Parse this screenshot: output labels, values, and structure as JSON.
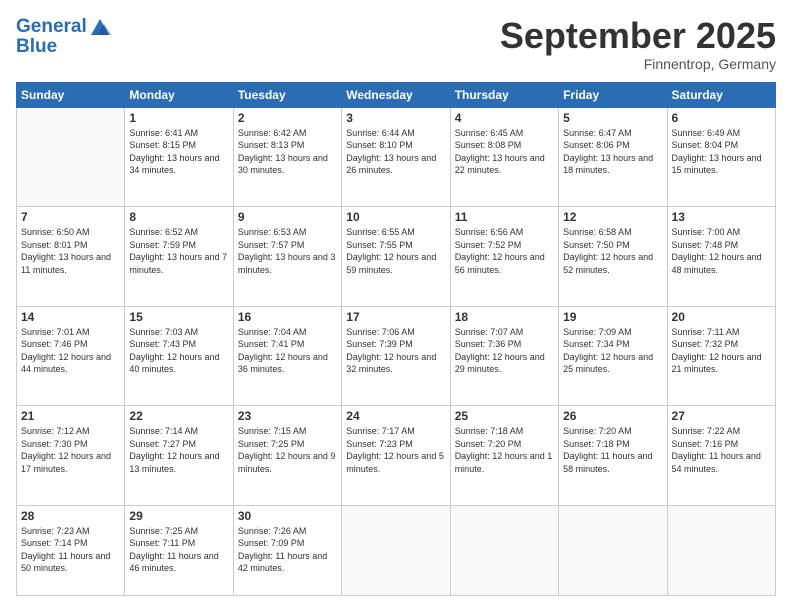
{
  "header": {
    "logo_line1": "General",
    "logo_line2": "Blue",
    "month": "September 2025",
    "location": "Finnentrop, Germany"
  },
  "weekdays": [
    "Sunday",
    "Monday",
    "Tuesday",
    "Wednesday",
    "Thursday",
    "Friday",
    "Saturday"
  ],
  "weeks": [
    [
      {
        "day": "",
        "sunrise": "",
        "sunset": "",
        "daylight": ""
      },
      {
        "day": "1",
        "sunrise": "Sunrise: 6:41 AM",
        "sunset": "Sunset: 8:15 PM",
        "daylight": "Daylight: 13 hours and 34 minutes."
      },
      {
        "day": "2",
        "sunrise": "Sunrise: 6:42 AM",
        "sunset": "Sunset: 8:13 PM",
        "daylight": "Daylight: 13 hours and 30 minutes."
      },
      {
        "day": "3",
        "sunrise": "Sunrise: 6:44 AM",
        "sunset": "Sunset: 8:10 PM",
        "daylight": "Daylight: 13 hours and 26 minutes."
      },
      {
        "day": "4",
        "sunrise": "Sunrise: 6:45 AM",
        "sunset": "Sunset: 8:08 PM",
        "daylight": "Daylight: 13 hours and 22 minutes."
      },
      {
        "day": "5",
        "sunrise": "Sunrise: 6:47 AM",
        "sunset": "Sunset: 8:06 PM",
        "daylight": "Daylight: 13 hours and 18 minutes."
      },
      {
        "day": "6",
        "sunrise": "Sunrise: 6:49 AM",
        "sunset": "Sunset: 8:04 PM",
        "daylight": "Daylight: 13 hours and 15 minutes."
      }
    ],
    [
      {
        "day": "7",
        "sunrise": "Sunrise: 6:50 AM",
        "sunset": "Sunset: 8:01 PM",
        "daylight": "Daylight: 13 hours and 11 minutes."
      },
      {
        "day": "8",
        "sunrise": "Sunrise: 6:52 AM",
        "sunset": "Sunset: 7:59 PM",
        "daylight": "Daylight: 13 hours and 7 minutes."
      },
      {
        "day": "9",
        "sunrise": "Sunrise: 6:53 AM",
        "sunset": "Sunset: 7:57 PM",
        "daylight": "Daylight: 13 hours and 3 minutes."
      },
      {
        "day": "10",
        "sunrise": "Sunrise: 6:55 AM",
        "sunset": "Sunset: 7:55 PM",
        "daylight": "Daylight: 12 hours and 59 minutes."
      },
      {
        "day": "11",
        "sunrise": "Sunrise: 6:56 AM",
        "sunset": "Sunset: 7:52 PM",
        "daylight": "Daylight: 12 hours and 56 minutes."
      },
      {
        "day": "12",
        "sunrise": "Sunrise: 6:58 AM",
        "sunset": "Sunset: 7:50 PM",
        "daylight": "Daylight: 12 hours and 52 minutes."
      },
      {
        "day": "13",
        "sunrise": "Sunrise: 7:00 AM",
        "sunset": "Sunset: 7:48 PM",
        "daylight": "Daylight: 12 hours and 48 minutes."
      }
    ],
    [
      {
        "day": "14",
        "sunrise": "Sunrise: 7:01 AM",
        "sunset": "Sunset: 7:46 PM",
        "daylight": "Daylight: 12 hours and 44 minutes."
      },
      {
        "day": "15",
        "sunrise": "Sunrise: 7:03 AM",
        "sunset": "Sunset: 7:43 PM",
        "daylight": "Daylight: 12 hours and 40 minutes."
      },
      {
        "day": "16",
        "sunrise": "Sunrise: 7:04 AM",
        "sunset": "Sunset: 7:41 PM",
        "daylight": "Daylight: 12 hours and 36 minutes."
      },
      {
        "day": "17",
        "sunrise": "Sunrise: 7:06 AM",
        "sunset": "Sunset: 7:39 PM",
        "daylight": "Daylight: 12 hours and 32 minutes."
      },
      {
        "day": "18",
        "sunrise": "Sunrise: 7:07 AM",
        "sunset": "Sunset: 7:36 PM",
        "daylight": "Daylight: 12 hours and 29 minutes."
      },
      {
        "day": "19",
        "sunrise": "Sunrise: 7:09 AM",
        "sunset": "Sunset: 7:34 PM",
        "daylight": "Daylight: 12 hours and 25 minutes."
      },
      {
        "day": "20",
        "sunrise": "Sunrise: 7:11 AM",
        "sunset": "Sunset: 7:32 PM",
        "daylight": "Daylight: 12 hours and 21 minutes."
      }
    ],
    [
      {
        "day": "21",
        "sunrise": "Sunrise: 7:12 AM",
        "sunset": "Sunset: 7:30 PM",
        "daylight": "Daylight: 12 hours and 17 minutes."
      },
      {
        "day": "22",
        "sunrise": "Sunrise: 7:14 AM",
        "sunset": "Sunset: 7:27 PM",
        "daylight": "Daylight: 12 hours and 13 minutes."
      },
      {
        "day": "23",
        "sunrise": "Sunrise: 7:15 AM",
        "sunset": "Sunset: 7:25 PM",
        "daylight": "Daylight: 12 hours and 9 minutes."
      },
      {
        "day": "24",
        "sunrise": "Sunrise: 7:17 AM",
        "sunset": "Sunset: 7:23 PM",
        "daylight": "Daylight: 12 hours and 5 minutes."
      },
      {
        "day": "25",
        "sunrise": "Sunrise: 7:18 AM",
        "sunset": "Sunset: 7:20 PM",
        "daylight": "Daylight: 12 hours and 1 minute."
      },
      {
        "day": "26",
        "sunrise": "Sunrise: 7:20 AM",
        "sunset": "Sunset: 7:18 PM",
        "daylight": "Daylight: 11 hours and 58 minutes."
      },
      {
        "day": "27",
        "sunrise": "Sunrise: 7:22 AM",
        "sunset": "Sunset: 7:16 PM",
        "daylight": "Daylight: 11 hours and 54 minutes."
      }
    ],
    [
      {
        "day": "28",
        "sunrise": "Sunrise: 7:23 AM",
        "sunset": "Sunset: 7:14 PM",
        "daylight": "Daylight: 11 hours and 50 minutes."
      },
      {
        "day": "29",
        "sunrise": "Sunrise: 7:25 AM",
        "sunset": "Sunset: 7:11 PM",
        "daylight": "Daylight: 11 hours and 46 minutes."
      },
      {
        "day": "30",
        "sunrise": "Sunrise: 7:26 AM",
        "sunset": "Sunset: 7:09 PM",
        "daylight": "Daylight: 11 hours and 42 minutes."
      },
      {
        "day": "",
        "sunrise": "",
        "sunset": "",
        "daylight": ""
      },
      {
        "day": "",
        "sunrise": "",
        "sunset": "",
        "daylight": ""
      },
      {
        "day": "",
        "sunrise": "",
        "sunset": "",
        "daylight": ""
      },
      {
        "day": "",
        "sunrise": "",
        "sunset": "",
        "daylight": ""
      }
    ]
  ]
}
